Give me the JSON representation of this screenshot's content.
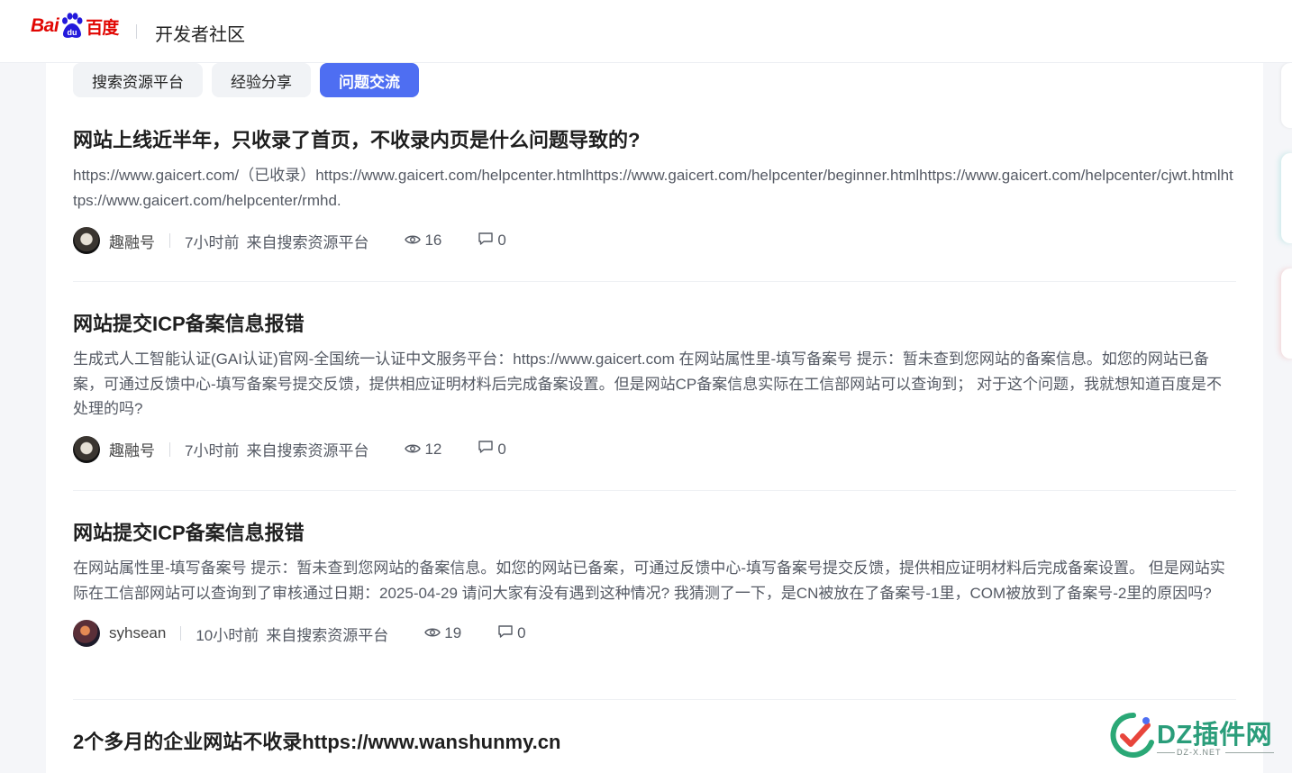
{
  "header": {
    "logo_text_left": "Bai",
    "logo_text_right": "百度",
    "title": "开发者社区"
  },
  "tabs": [
    {
      "label": "搜索资源平台",
      "active": false
    },
    {
      "label": "经验分享",
      "active": false
    },
    {
      "label": "问题交流",
      "active": true
    }
  ],
  "posts": [
    {
      "title": "网站上线近半年，只收录了首页，不收录内页是什么问题导致的?",
      "body": "https://www.gaicert.com/（已收录）https://www.gaicert.com/helpcenter.htmlhttps://www.gaicert.com/helpcenter/beginner.htmlhttps://www.gaicert.com/helpcenter/cjwt.htmlhttps://www.gaicert.com/helpcenter/rmhd.",
      "author": "趣融号",
      "time": "7小时前",
      "source": "来自搜索资源平台",
      "views": "16",
      "comments": "0"
    },
    {
      "title": "网站提交ICP备案信息报错",
      "body": "生成式人工智能认证(GAI认证)官网-全国统一认证中文服务平台：https://www.gaicert.com 在网站属性里-填写备案号 提示：暂未查到您网站的备案信息。如您的网站已备案，可通过反馈中心-填写备案号提交反馈，提供相应证明材料后完成备案设置。但是网站CP备案信息实际在工信部网站可以查询到； 对于这个问题，我就想知道百度是不处理的吗?",
      "author": "趣融号",
      "time": "7小时前",
      "source": "来自搜索资源平台",
      "views": "12",
      "comments": "0"
    },
    {
      "title": "网站提交ICP备案信息报错",
      "body": "在网站属性里-填写备案号 提示：暂未查到您网站的备案信息。如您的网站已备案，可通过反馈中心-填写备案号提交反馈，提供相应证明材料后完成备案设置。 但是网站实际在工信部网站可以查询到了审核通过日期：2025-04-29 请问大家有没有遇到这种情况? 我猜测了一下，是CN被放在了备案号-1里，COM被放到了备案号-2里的原因吗?",
      "author": "syhsean",
      "time": "10小时前",
      "source": "来自搜索资源平台",
      "views": "19",
      "comments": "0"
    },
    {
      "title": "2个多月的企业网站不收录https://www.wanshunmy.cn"
    }
  ],
  "watermark": {
    "text": "DZ插件网",
    "sub": "DZ-X.NET"
  },
  "colors": {
    "accent": "#4e6ef2",
    "brand_red": "#e10602",
    "watermark_green": "#2a9d7a"
  }
}
